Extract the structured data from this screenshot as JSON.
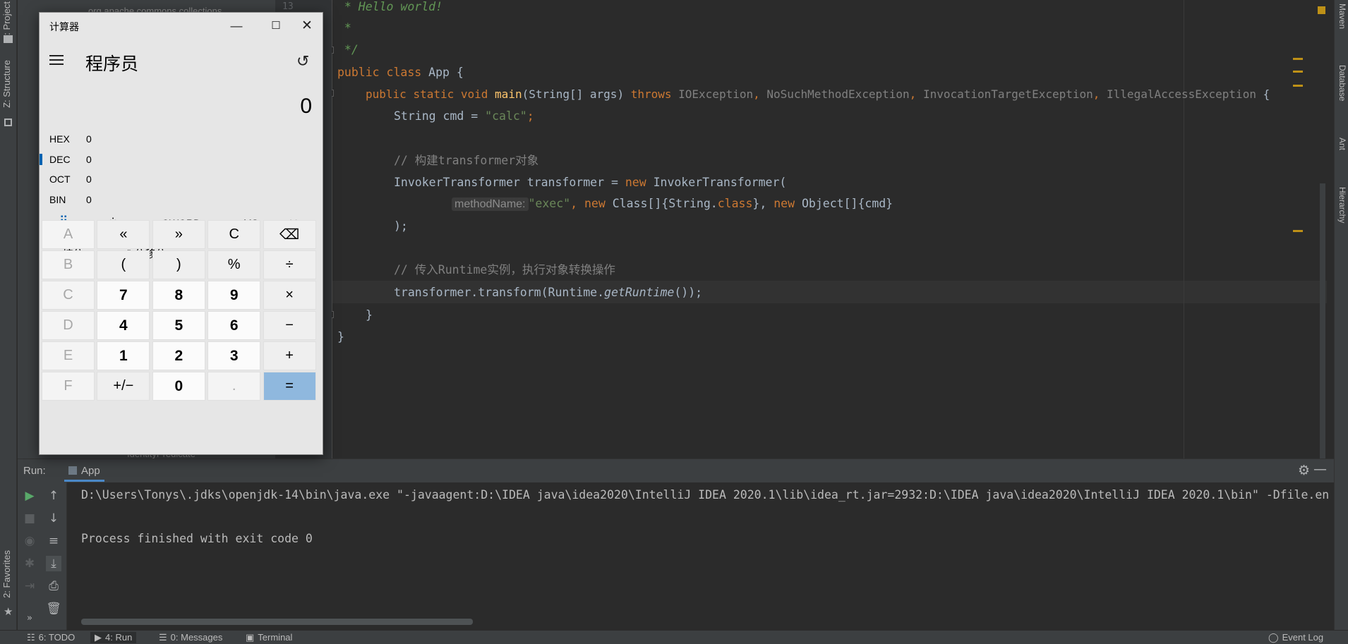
{
  "left_strip": {
    "project_tab": "1: Project",
    "structure_tab": "Z: Structure",
    "favorites_tab": "2: Favorites"
  },
  "right_strip": {
    "maven_tab": "Maven",
    "database_tab": "Database",
    "ant_tab": "Ant",
    "hierarchy_tab": "Hierarchy"
  },
  "project_panel": {
    "top_item": "org.apache.commons.collections",
    "bottom_item": "IdentityPredicate"
  },
  "editor": {
    "line_number": "13",
    "lines": [
      {
        "doc": " * Hello world!"
      },
      {
        "doc": " *"
      },
      {
        "doc": " */"
      },
      {
        "kw1": "public",
        "kw2": "class",
        "name": "App",
        "rest": " {"
      },
      {
        "kw1": "public",
        "kw2": "static",
        "kw3": "void",
        "fn": "main",
        "args": "(String[] args) ",
        "throws": "throws",
        "ex1": "IOException",
        "ex2": "NoSuchMethodException",
        "ex3": "InvocationTargetException",
        "ex4": "IllegalAccessException",
        "end": " {"
      },
      {
        "pre": "String cmd = ",
        "str": "\"calc\"",
        "end": ";"
      },
      {
        "comment": "// 构建transformer对象"
      },
      {
        "pre": "InvokerTransformer transformer = ",
        "kw": "new",
        "post": " InvokerTransformer("
      },
      {
        "hint": "methodName:",
        "str": "\"exec\"",
        "c1": ", ",
        "kw1": "new",
        "a1": " Class[]{String.",
        "kw2": "class",
        "a2": "}, ",
        "kw3": "new",
        "a3": " Object[]{cmd}"
      },
      {
        "text": ");"
      },
      {
        "comment": "// 传入Runtime实例，执行对象转换操作"
      },
      {
        "pre": "transformer.transform(Runtime.",
        "italic": "getRuntime",
        "end": "());"
      },
      {
        "text": "}"
      },
      {
        "text": "}"
      }
    ]
  },
  "run_panel": {
    "label": "Run:",
    "tab": "App",
    "console": [
      "D:\\Users\\Tonys\\.jdks\\openjdk-14\\bin\\java.exe \"-javaagent:D:\\IDEA java\\idea2020\\IntelliJ IDEA 2020.1\\lib\\idea_rt.jar=2932:D:\\IDEA java\\idea2020\\IntelliJ IDEA 2020.1\\bin\" -Dfile.en",
      "Process finished with exit code 0"
    ]
  },
  "status_bar": {
    "todo": "6: TODO",
    "run": "4: Run",
    "messages": "0: Messages",
    "terminal": "Terminal",
    "event_log": "Event Log"
  },
  "calculator": {
    "title": "计算器",
    "mode": "程序员",
    "display": "0",
    "radix": [
      {
        "name": "HEX",
        "value": "0"
      },
      {
        "name": "DEC",
        "value": "0"
      },
      {
        "name": "OCT",
        "value": "0"
      },
      {
        "name": "BIN",
        "value": "0"
      }
    ],
    "word_size": "QWORD",
    "ms": "MS",
    "mr": "M˅",
    "bitwise": "按位",
    "bitshift": "位移位",
    "keys": [
      [
        "A",
        "«",
        "»",
        "C",
        "⌫"
      ],
      [
        "B",
        "(",
        ")",
        "%",
        "÷"
      ],
      [
        "C",
        "7",
        "8",
        "9",
        "×"
      ],
      [
        "D",
        "4",
        "5",
        "6",
        "−"
      ],
      [
        "E",
        "1",
        "2",
        "3",
        "+"
      ],
      [
        "F",
        "+/−",
        "0",
        ".",
        "="
      ]
    ]
  },
  "colors": {
    "accent": "#0063b1",
    "equals_key": "#8fb8de",
    "editor_bg": "#2b2b2b",
    "keyword": "#cc7832",
    "string": "#6a8759"
  }
}
